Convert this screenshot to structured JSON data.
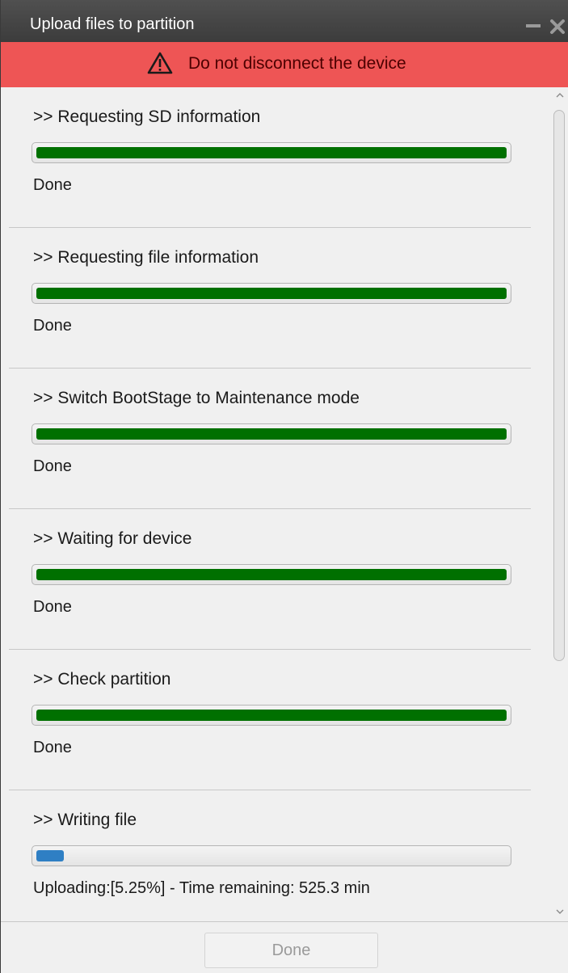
{
  "window": {
    "title": "Upload files to partition",
    "minimize_glyph": "—",
    "close_glyph": "✕"
  },
  "warning": {
    "icon": "warning-triangle-icon",
    "text": "Do not disconnect the device",
    "background": "#ee5555"
  },
  "steps": [
    {
      "title": ">> Requesting SD information",
      "status": "Done",
      "progress": 1.0,
      "bar_color": "#007000"
    },
    {
      "title": ">> Requesting file information",
      "status": "Done",
      "progress": 1.0,
      "bar_color": "#007000"
    },
    {
      "title": ">> Switch BootStage to Maintenance mode",
      "status": "Done",
      "progress": 1.0,
      "bar_color": "#007000"
    },
    {
      "title": ">> Waiting for device",
      "status": "Done",
      "progress": 1.0,
      "bar_color": "#007000"
    },
    {
      "title": ">> Check partition",
      "status": "Done",
      "progress": 1.0,
      "bar_color": "#007000"
    },
    {
      "title": ">> Writing file",
      "status": "Uploading:[5.25%] - Time remaining: 525.3 min",
      "progress": 0.0525,
      "bar_color": "#2f7fc4"
    }
  ],
  "footer": {
    "done_label": "Done"
  }
}
